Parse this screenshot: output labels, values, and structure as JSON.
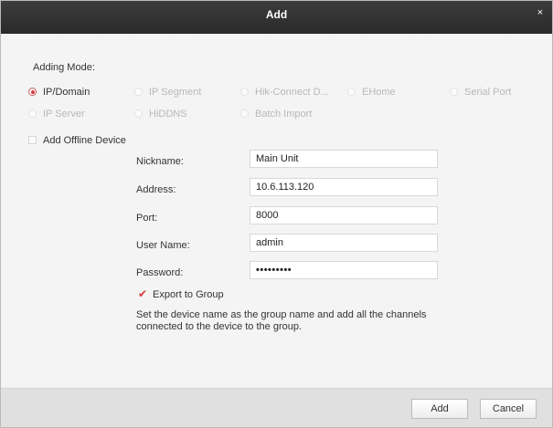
{
  "window": {
    "title": "Add",
    "close_glyph": "×"
  },
  "adding_mode": {
    "label": "Adding Mode:",
    "options": [
      {
        "label": "IP/Domain",
        "selected": true
      },
      {
        "label": "IP Segment",
        "selected": false
      },
      {
        "label": "Hik-Connect D...",
        "selected": false
      },
      {
        "label": "EHome",
        "selected": false
      },
      {
        "label": "Serial Port",
        "selected": false
      },
      {
        "label": "IP Server",
        "selected": false
      },
      {
        "label": "HiDDNS",
        "selected": false
      },
      {
        "label": "Batch Import",
        "selected": false
      }
    ]
  },
  "offline": {
    "label": "Add Offline Device",
    "checked": false
  },
  "form": {
    "fields": [
      {
        "label": "Nickname:",
        "value": "Main Unit"
      },
      {
        "label": "Address:",
        "value": "10.6.113.120"
      },
      {
        "label": "Port:",
        "value": "8000"
      },
      {
        "label": "User Name:",
        "value": "admin"
      },
      {
        "label": "Password:",
        "value": "•••••••••"
      }
    ]
  },
  "export_group": {
    "label": "Export to Group",
    "checked": true,
    "check_glyph": "✔",
    "description": "Set the device name as the group name and add all the channels connected to the device to the group."
  },
  "buttons": {
    "add": "Add",
    "cancel": "Cancel"
  },
  "colors": {
    "titlebar": "#333333",
    "accent": "#d03a3a",
    "footer": "#e0e0e0"
  }
}
